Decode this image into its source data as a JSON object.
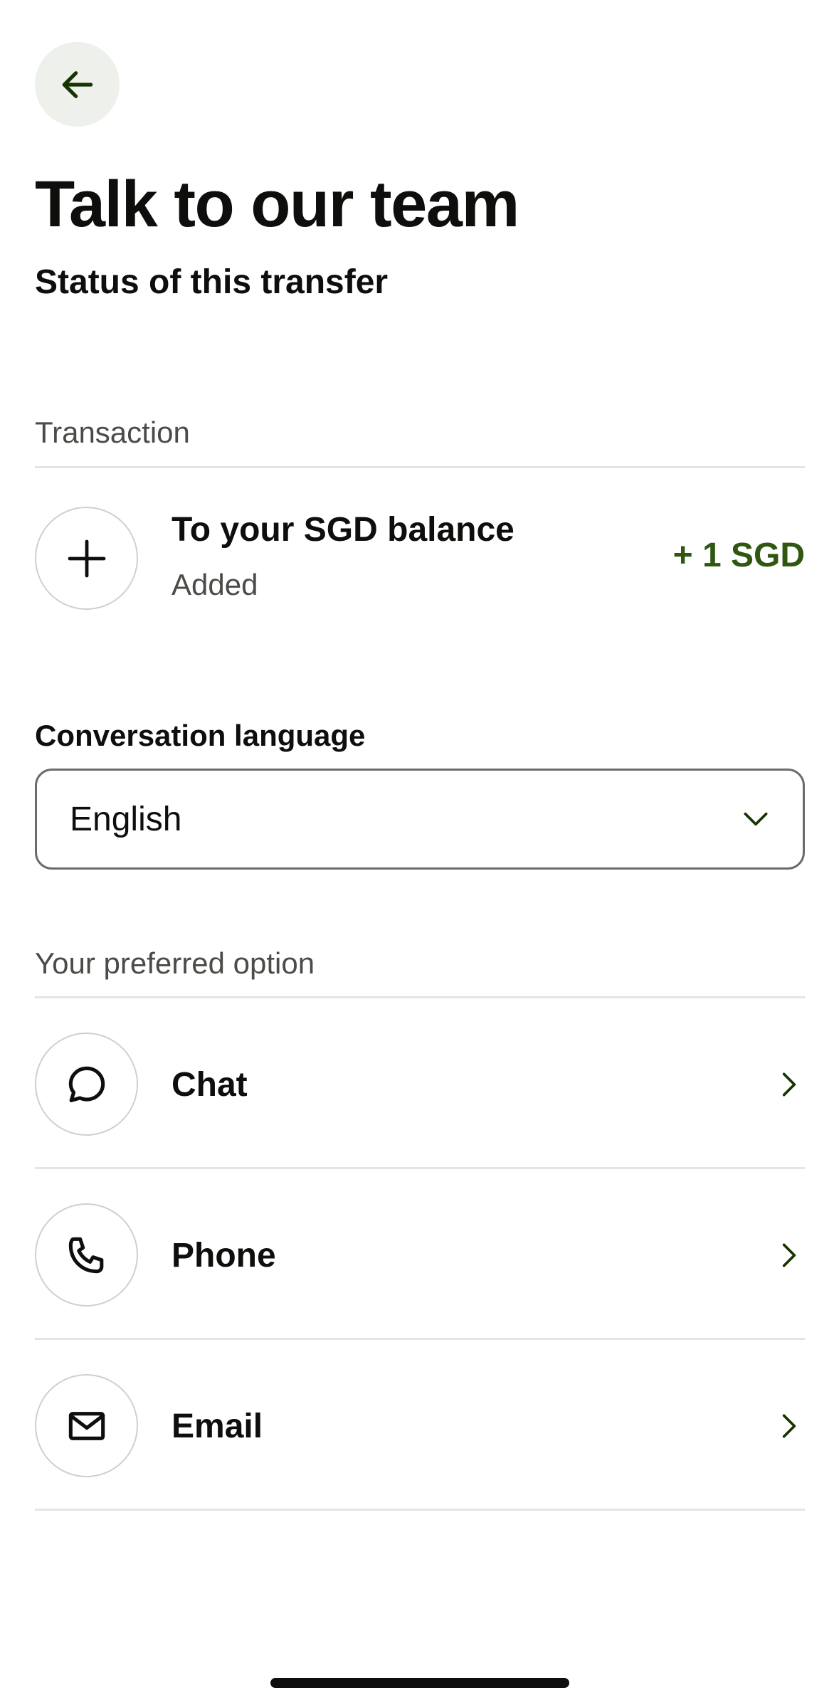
{
  "header": {
    "back_icon": "arrow-left-icon",
    "title": "Talk to our team",
    "subtitle": "Status of this transfer"
  },
  "transaction": {
    "section_label": "Transaction",
    "icon": "plus-icon",
    "title": "To your SGD balance",
    "status": "Added",
    "amount": "+ 1 SGD",
    "amount_color": "#2f5711"
  },
  "language": {
    "label": "Conversation language",
    "selected": "English",
    "icon": "chevron-down-icon"
  },
  "options": {
    "section_label": "Your preferred option",
    "items": [
      {
        "label": "Chat",
        "icon": "chat-bubble-icon"
      },
      {
        "label": "Phone",
        "icon": "phone-icon"
      },
      {
        "label": "Email",
        "icon": "envelope-icon"
      }
    ]
  },
  "colors": {
    "accent_dark_green": "#163300",
    "back_button_bg": "#eef0ec",
    "text_primary": "#0e0f0c",
    "text_secondary": "#4a4c48"
  }
}
